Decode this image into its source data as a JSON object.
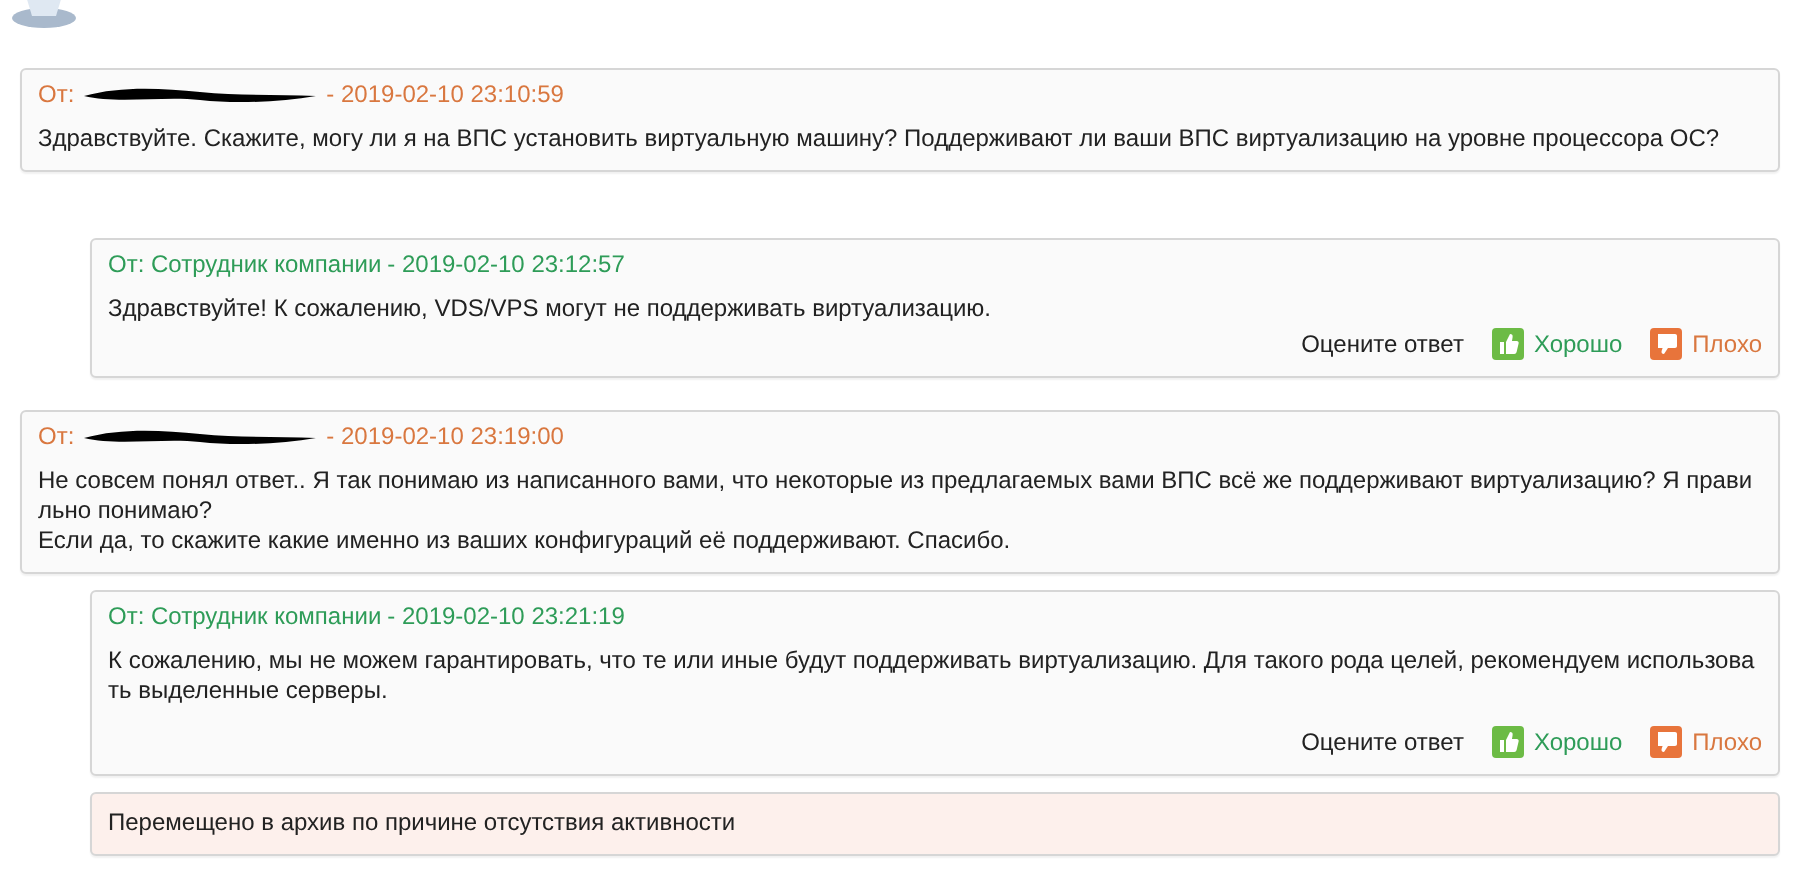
{
  "messages": [
    {
      "kind": "client",
      "author": "От:",
      "redacted": true,
      "date": "- 2019-02-10 23:10:59",
      "text": "Здравствуйте. Скажите, могу ли я на ВПС установить виртуальную машину? Поддерживают ли ваши ВПС виртуализацию на уровне процессора ОС?"
    },
    {
      "kind": "staff",
      "author": "От: Сотрудник компании",
      "redacted": false,
      "date": "- 2019-02-10 23:12:57",
      "text": "Здравствуйте! К сожалению, VDS/VPS могут не поддерживать виртуализацию.",
      "rating": {
        "prompt": "Оцените ответ",
        "good": "Хорошо",
        "bad": "Плохо"
      }
    },
    {
      "kind": "client",
      "author": "От:",
      "redacted": true,
      "date": "- 2019-02-10 23:19:00",
      "text": "Не совсем понял ответ.. Я так понимаю из написанного вами, что некоторые из предлагаемых вами ВПС всё же поддерживают виртуализацию? Я правильно понимаю?\nЕсли да, то скажите какие именно из ваших конфигураций её поддерживают. Спасибо."
    },
    {
      "kind": "staff",
      "author": "От: Сотрудник компании",
      "redacted": false,
      "date": "- 2019-02-10 23:21:19",
      "text": "К сожалению, мы не можем гарантировать, что те или иные будут поддерживать виртуализацию. Для такого рода целей, рекомендуем использовать выделенные серверы.",
      "rating": {
        "prompt": "Оцените ответ",
        "good": "Хорошо",
        "bad": "Плохо"
      }
    },
    {
      "kind": "notice",
      "text": "Перемещено в архив по причине отсутствия активности"
    }
  ]
}
